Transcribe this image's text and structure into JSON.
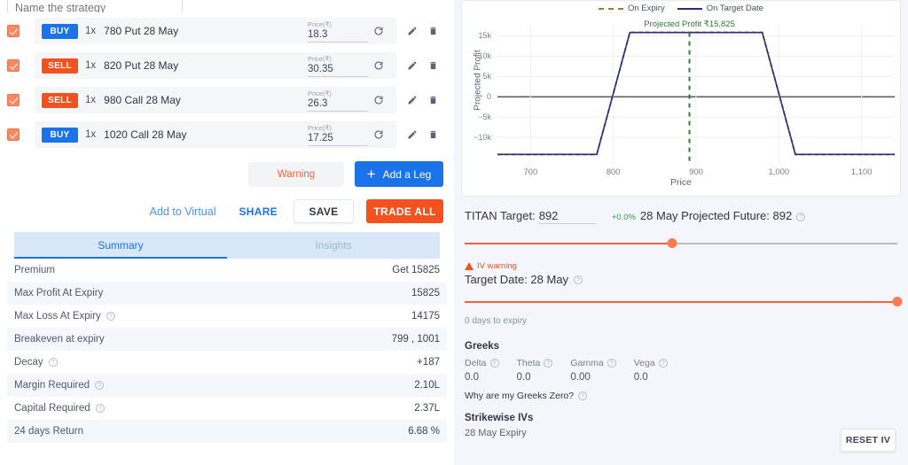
{
  "strategy": {
    "name_placeholder": "Name the strategy",
    "name_value": ""
  },
  "legs": [
    {
      "action": "BUY",
      "qty": "1x",
      "desc": "780 Put 28 May",
      "price_label": "Price(₹)",
      "price": "18.3",
      "checked": true
    },
    {
      "action": "SELL",
      "qty": "1x",
      "desc": "820 Put 28 May",
      "price_label": "Price(₹)",
      "price": "30.35",
      "checked": true
    },
    {
      "action": "SELL",
      "qty": "1x",
      "desc": "980 Call 28 May",
      "price_label": "Price(₹)",
      "price": "26.3",
      "checked": true
    },
    {
      "action": "BUY",
      "qty": "1x",
      "desc": "1020 Call 28 May",
      "price_label": "Price(₹)",
      "price": "17.25",
      "checked": true
    }
  ],
  "leg_actions": {
    "warning_label": "Warning",
    "add_leg_label": "Add a Leg"
  },
  "save_row": {
    "add_to_virtual": "Add to Virtual",
    "share": "SHARE",
    "save": "SAVE",
    "trade_all": "TRADE ALL"
  },
  "tabs": [
    {
      "label": "Summary",
      "active": true
    },
    {
      "label": "Insights",
      "active": false
    }
  ],
  "summary_rows": [
    {
      "label": "Premium",
      "value": "Get 15825",
      "help": false
    },
    {
      "label": "Max Profit At Expiry",
      "value": "15825",
      "help": false
    },
    {
      "label": "Max Loss At Expiry",
      "value": "14175",
      "help": true
    },
    {
      "label": "Breakeven at expiry",
      "value": "799 , 1001",
      "help": false
    },
    {
      "label": "Decay",
      "value": "+187",
      "help": true
    },
    {
      "label": "Margin Required",
      "value": "2.10L",
      "help": true
    },
    {
      "label": "Capital Required",
      "value": "2.37L",
      "help": true
    },
    {
      "label": "24 days Return",
      "value": "6.68 %",
      "help": false
    }
  ],
  "chart_data": {
    "type": "line",
    "title": "",
    "xlabel": "Price",
    "ylabel": "Projected Profit",
    "xlim": [
      660,
      1140
    ],
    "ylim": [
      -16500,
      17500
    ],
    "xticks": [
      700,
      800,
      900,
      1000,
      1100
    ],
    "xtick_labels": [
      "700",
      "800",
      "900",
      "1,000",
      "1,100"
    ],
    "yticks": [
      15000,
      10000,
      5000,
      0,
      -5000,
      -10000
    ],
    "ytick_labels": [
      "15k",
      "10k",
      "5k",
      "0",
      "−5k",
      "−10k"
    ],
    "grid": true,
    "legend_position": "top-center",
    "zero_line": 0,
    "series": [
      {
        "name": "On Expiry",
        "style": "dashed",
        "color": "#a8713f",
        "x": [
          660,
          780,
          820,
          980,
          1020,
          1140
        ],
        "y": [
          -14175,
          -14175,
          15825,
          15825,
          -14175,
          -14175
        ]
      },
      {
        "name": "On Target Date",
        "style": "solid",
        "color": "#2b2f7a",
        "x": [
          660,
          780,
          820,
          980,
          1020,
          1140
        ],
        "y": [
          -14175,
          -14175,
          15825,
          15825,
          -14175,
          -14175
        ]
      }
    ],
    "annotations": [
      {
        "text": "Projected Profit ₹15,825",
        "x": 892,
        "y": 15825,
        "color": "#2e7d32"
      }
    ],
    "vertical_marker": {
      "x": 892,
      "color": "#2e7d32",
      "style": "dashed"
    }
  },
  "target": {
    "titan_label": "TITAN Target:",
    "titan_value": "892",
    "pct_change": "+0.0%",
    "projected_future_label": "28 May Projected Future: 892",
    "slider_percent": 48,
    "iv_warning": "IV warning",
    "target_date_label": "Target Date: 28 May",
    "date_slider_percent": 100,
    "days_to_expiry": "0 days to expiry"
  },
  "greeks": {
    "heading": "Greeks",
    "items": [
      {
        "name": "Delta",
        "value": "0.0"
      },
      {
        "name": "Theta",
        "value": "0.0"
      },
      {
        "name": "Gamma",
        "value": "0.00"
      },
      {
        "name": "Vega",
        "value": "0.0"
      }
    ],
    "why_zero": "Why are my Greeks Zero?"
  },
  "strikewise": {
    "heading": "Strikewise IVs",
    "expiry": "28 May Expiry",
    "reset_label": "RESET IV"
  },
  "colors": {
    "buy": "#1a73e8",
    "sell": "#f4511e",
    "accent_orange": "#f4633a",
    "profit_green": "#2e7d32",
    "target_line": "#2b2f7a",
    "expiry_line": "#a8713f"
  }
}
